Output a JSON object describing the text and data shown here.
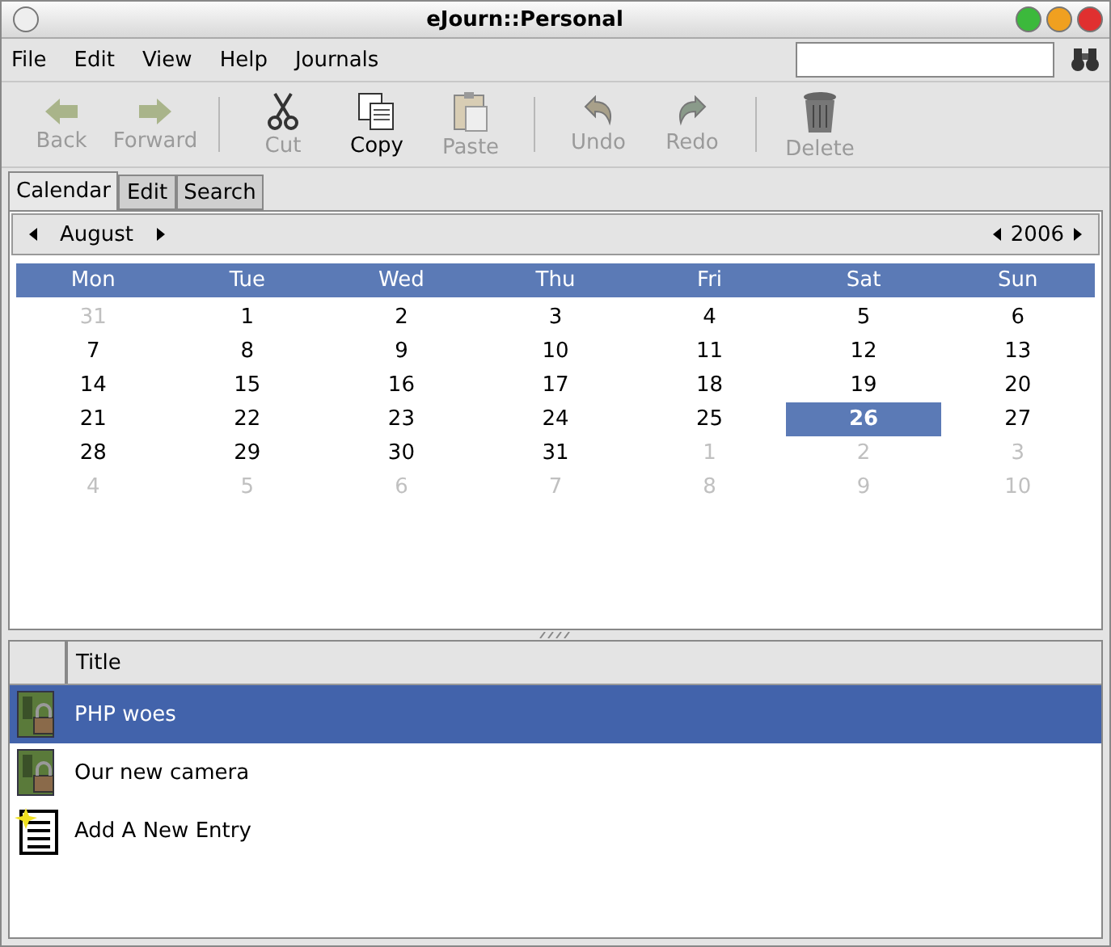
{
  "window": {
    "title": "eJourn::Personal"
  },
  "menu": [
    "File",
    "Edit",
    "View",
    "Help",
    "Journals"
  ],
  "toolbar_groups": [
    [
      {
        "label": "Back",
        "disabled": true
      },
      {
        "label": "Forward",
        "disabled": true
      }
    ],
    [
      {
        "label": "Cut",
        "disabled": true
      },
      {
        "label": "Copy",
        "disabled": false
      },
      {
        "label": "Paste",
        "disabled": true
      }
    ],
    [
      {
        "label": "Undo",
        "disabled": true
      },
      {
        "label": "Redo",
        "disabled": true
      }
    ],
    [
      {
        "label": "Delete",
        "disabled": true
      }
    ]
  ],
  "tabs": [
    {
      "label": "Calendar",
      "selected": true
    },
    {
      "label": "Edit",
      "selected": false
    },
    {
      "label": "Search",
      "selected": false
    }
  ],
  "calendar": {
    "month": "August",
    "year": "2006",
    "weekdays": [
      "Mon",
      "Tue",
      "Wed",
      "Thu",
      "Fri",
      "Sat",
      "Sun"
    ],
    "weeks": [
      [
        {
          "day": "31",
          "other_month": true,
          "selected": false
        },
        {
          "day": "1",
          "other_month": false,
          "selected": false
        },
        {
          "day": "2",
          "other_month": false,
          "selected": false
        },
        {
          "day": "3",
          "other_month": false,
          "selected": false
        },
        {
          "day": "4",
          "other_month": false,
          "selected": false
        },
        {
          "day": "5",
          "other_month": false,
          "selected": false
        },
        {
          "day": "6",
          "other_month": false,
          "selected": false
        }
      ],
      [
        {
          "day": "7",
          "other_month": false,
          "selected": false
        },
        {
          "day": "8",
          "other_month": false,
          "selected": false
        },
        {
          "day": "9",
          "other_month": false,
          "selected": false
        },
        {
          "day": "10",
          "other_month": false,
          "selected": false
        },
        {
          "day": "11",
          "other_month": false,
          "selected": false
        },
        {
          "day": "12",
          "other_month": false,
          "selected": false
        },
        {
          "day": "13",
          "other_month": false,
          "selected": false
        }
      ],
      [
        {
          "day": "14",
          "other_month": false,
          "selected": false
        },
        {
          "day": "15",
          "other_month": false,
          "selected": false
        },
        {
          "day": "16",
          "other_month": false,
          "selected": false
        },
        {
          "day": "17",
          "other_month": false,
          "selected": false
        },
        {
          "day": "18",
          "other_month": false,
          "selected": false
        },
        {
          "day": "19",
          "other_month": false,
          "selected": false
        },
        {
          "day": "20",
          "other_month": false,
          "selected": false
        }
      ],
      [
        {
          "day": "21",
          "other_month": false,
          "selected": false
        },
        {
          "day": "22",
          "other_month": false,
          "selected": false
        },
        {
          "day": "23",
          "other_month": false,
          "selected": false
        },
        {
          "day": "24",
          "other_month": false,
          "selected": false
        },
        {
          "day": "25",
          "other_month": false,
          "selected": false
        },
        {
          "day": "26",
          "other_month": false,
          "selected": true
        },
        {
          "day": "27",
          "other_month": false,
          "selected": false
        }
      ],
      [
        {
          "day": "28",
          "other_month": false,
          "selected": false
        },
        {
          "day": "29",
          "other_month": false,
          "selected": false
        },
        {
          "day": "30",
          "other_month": false,
          "selected": false
        },
        {
          "day": "31",
          "other_month": false,
          "selected": false
        },
        {
          "day": "1",
          "other_month": true,
          "selected": false
        },
        {
          "day": "2",
          "other_month": true,
          "selected": false
        },
        {
          "day": "3",
          "other_month": true,
          "selected": false
        }
      ],
      [
        {
          "day": "4",
          "other_month": true,
          "selected": false
        },
        {
          "day": "5",
          "other_month": true,
          "selected": false
        },
        {
          "day": "6",
          "other_month": true,
          "selected": false
        },
        {
          "day": "7",
          "other_month": true,
          "selected": false
        },
        {
          "day": "8",
          "other_month": true,
          "selected": false
        },
        {
          "day": "9",
          "other_month": true,
          "selected": false
        },
        {
          "day": "10",
          "other_month": true,
          "selected": false
        }
      ]
    ]
  },
  "entries": {
    "columns": [
      "Title"
    ],
    "rows": [
      {
        "kind": "entry",
        "title": "PHP woes",
        "selected": true
      },
      {
        "kind": "entry",
        "title": "Our new camera",
        "selected": false
      },
      {
        "kind": "new",
        "title": "Add A New Entry",
        "selected": false
      }
    ]
  }
}
